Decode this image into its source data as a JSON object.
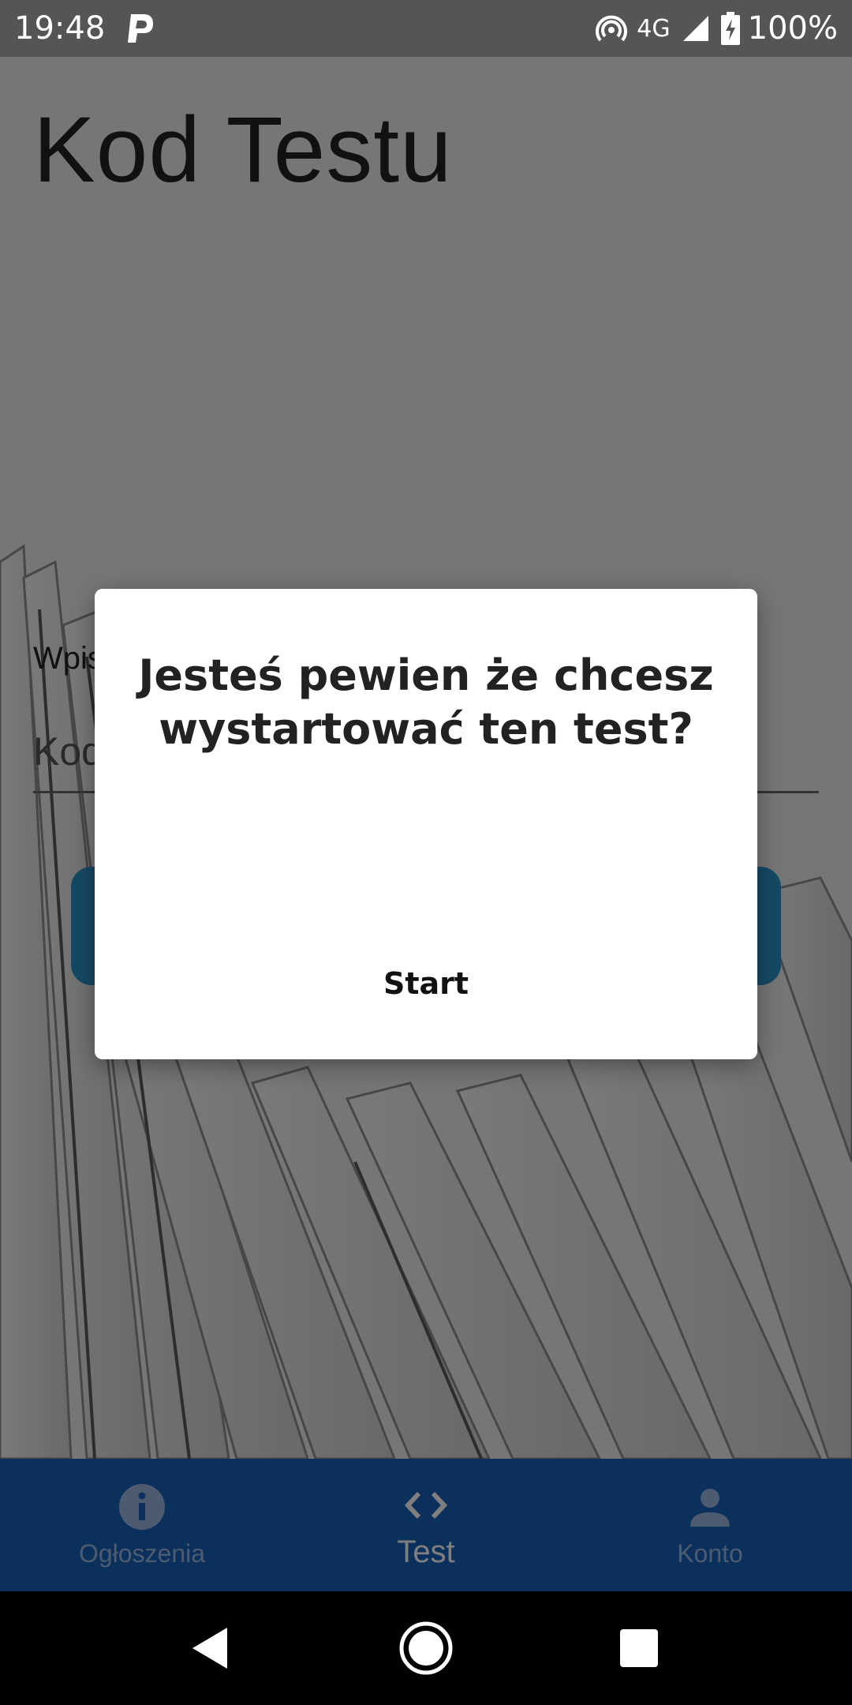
{
  "status_bar": {
    "time": "19:48",
    "network": "4G",
    "battery": "100%",
    "icons": [
      "parking-app-icon",
      "hotspot-icon",
      "signal-icon",
      "battery-charging-icon"
    ]
  },
  "page": {
    "title": "Kod Testu",
    "code_label": "Wpis",
    "code_placeholder": "Kod"
  },
  "dialog": {
    "message": "Jesteś pewien że chcesz wystartować ten test?",
    "start_label": "Start"
  },
  "bottom_nav": {
    "items": [
      {
        "label": "Ogłoszenia",
        "icon": "info-icon",
        "active": false
      },
      {
        "label": "Test",
        "icon": "code-icon",
        "active": true
      },
      {
        "label": "Konto",
        "icon": "person-icon",
        "active": false
      }
    ]
  },
  "system_nav": {
    "icons": [
      "back-icon",
      "home-icon",
      "recents-icon"
    ]
  },
  "colors": {
    "nav_background": "#1561b7",
    "button_accent": "#2a93c9",
    "status_bar": "#555555"
  }
}
